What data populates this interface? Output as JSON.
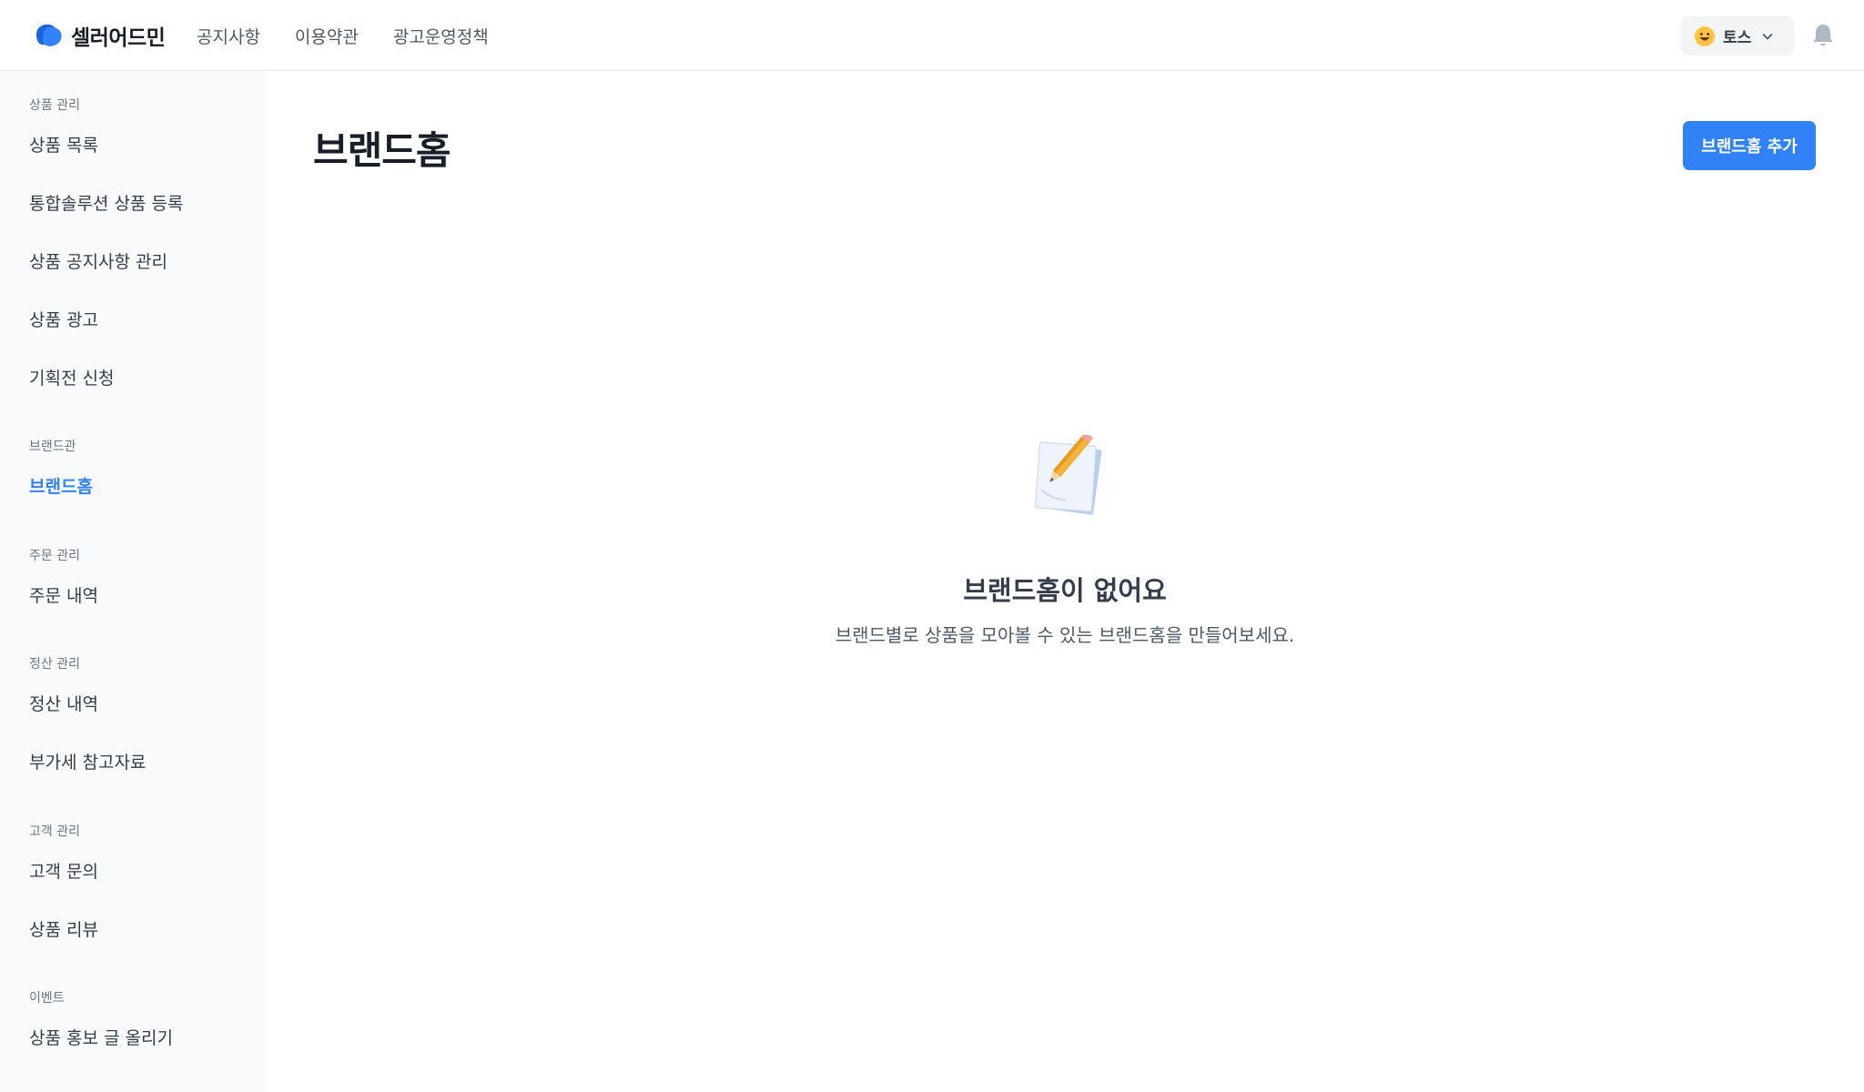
{
  "app": {
    "logo_text": "셀러어드민"
  },
  "topnav": {
    "items": [
      "공지사항",
      "이용약관",
      "광고운영정책"
    ]
  },
  "account": {
    "name": "토스"
  },
  "sidebar": {
    "sections": [
      {
        "label": "상품 관리",
        "items": [
          "상품 목록",
          "통합솔루션 상품 등록",
          "상품 공지사항 관리",
          "상품 광고",
          "기획전 신청"
        ]
      },
      {
        "label": "브랜드관",
        "items": [
          "브랜드홈"
        ]
      },
      {
        "label": "주문 관리",
        "items": [
          "주문 내역"
        ]
      },
      {
        "label": "정산 관리",
        "items": [
          "정산 내역",
          "부가세 참고자료"
        ]
      },
      {
        "label": "고객 관리",
        "items": [
          "고객 문의",
          "상품 리뷰"
        ]
      },
      {
        "label": "이벤트",
        "items": [
          "상품 홍보 글 올리기"
        ]
      }
    ],
    "active_item": "브랜드홈"
  },
  "main": {
    "title": "브랜드홈",
    "add_button_label": "브랜드홈 추가",
    "empty": {
      "title": "브랜드홈이 없어요",
      "description": "브랜드별로 상품을 모아볼 수 있는 브랜드홈을 만들어보세요."
    }
  },
  "colors": {
    "accent": "#3182f6",
    "sidebar_bg": "#f9fafb"
  },
  "icons": {
    "logo": "toss-logo-icon",
    "account_avatar": "smiley-icon",
    "account_toggle": "chevron-down-icon",
    "notifications": "bell-icon",
    "empty_state": "pencil-paper-icon"
  }
}
